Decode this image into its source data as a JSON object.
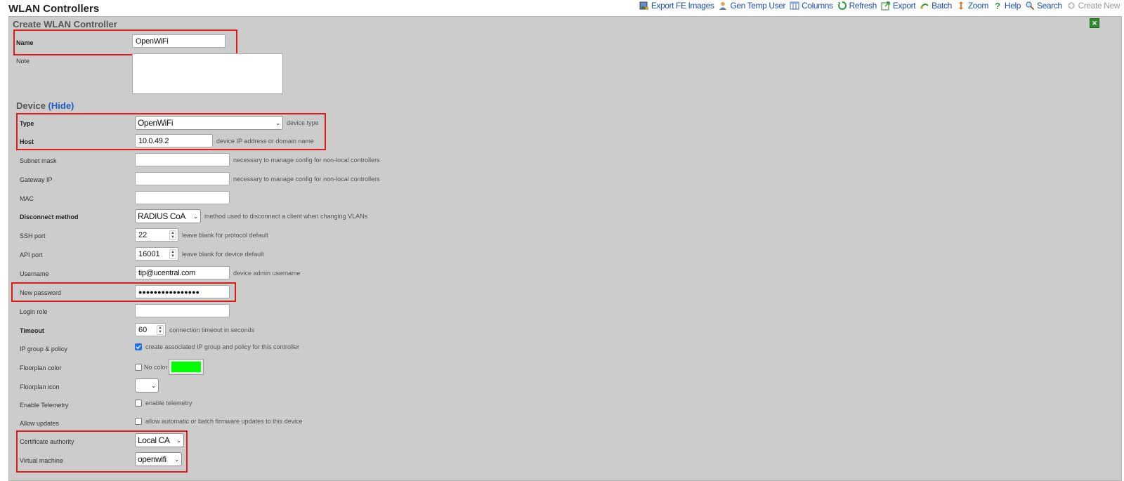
{
  "page": {
    "title": "WLAN Controllers"
  },
  "toolbar": {
    "export_fe_images": "Export FE Images",
    "gen_temp_user": "Gen Temp User",
    "columns": "Columns",
    "refresh": "Refresh",
    "export": "Export",
    "batch": "Batch",
    "zoom": "Zoom",
    "help": "Help",
    "search": "Search",
    "create_new": "Create New"
  },
  "form": {
    "title": "Create WLAN Controller",
    "name": {
      "label": "Name",
      "value": "OpenWiFi"
    },
    "note": {
      "label": "Note",
      "value": ""
    }
  },
  "device": {
    "section_title": "Device",
    "hide_link": "(Hide)",
    "type": {
      "label": "Type",
      "value": "OpenWiFi",
      "hint": "device type"
    },
    "host": {
      "label": "Host",
      "value": "10.0.49.2",
      "hint": "device IP address or domain name"
    },
    "subnet_mask": {
      "label": "Subnet mask",
      "value": "",
      "hint": "necessary to manage config for non-local controllers"
    },
    "gateway_ip": {
      "label": "Gateway IP",
      "value": "",
      "hint": "necessary to manage config for non-local controllers"
    },
    "mac": {
      "label": "MAC",
      "value": ""
    },
    "disconnect_method": {
      "label": "Disconnect method",
      "value": "RADIUS CoA",
      "hint": "method used to disconnect a client when changing VLANs"
    },
    "ssh_port": {
      "label": "SSH port",
      "value": "22",
      "hint": "leave blank for protocol default"
    },
    "api_port": {
      "label": "API port",
      "value": "16001",
      "hint": "leave blank for device default"
    },
    "username": {
      "label": "Username",
      "value": "tip@ucentral.com",
      "hint": "device admin username"
    },
    "new_password": {
      "label": "New password",
      "value": "●●●●●●●●●●●●●●●●"
    },
    "login_role": {
      "label": "Login role",
      "value": ""
    },
    "timeout": {
      "label": "Timeout",
      "value": "60",
      "hint": "connection timeout in seconds"
    },
    "ip_group_policy": {
      "label": "IP group & policy",
      "hint": "create associated IP group and policy for this controller",
      "checked": true
    },
    "floorplan_color": {
      "label": "Floorplan color",
      "option": "No color",
      "swatch": "#00ff00",
      "checked": false
    },
    "floorplan_icon": {
      "label": "Floorplan icon",
      "value": ""
    },
    "enable_telemetry": {
      "label": "Enable Telemetry",
      "hint": "enable telemetry",
      "checked": false
    },
    "allow_updates": {
      "label": "Allow updates",
      "hint": "allow automatic or batch firmware updates to this device",
      "checked": false
    },
    "certificate_authority": {
      "label": "Certificate authority",
      "value": "Local CA"
    },
    "virtual_machine": {
      "label": "Virtual machine",
      "value": "openwifi"
    }
  },
  "colors": {
    "highlight": "#e01b1b",
    "link": "#1a4fb5",
    "panel": "#cccccc"
  }
}
